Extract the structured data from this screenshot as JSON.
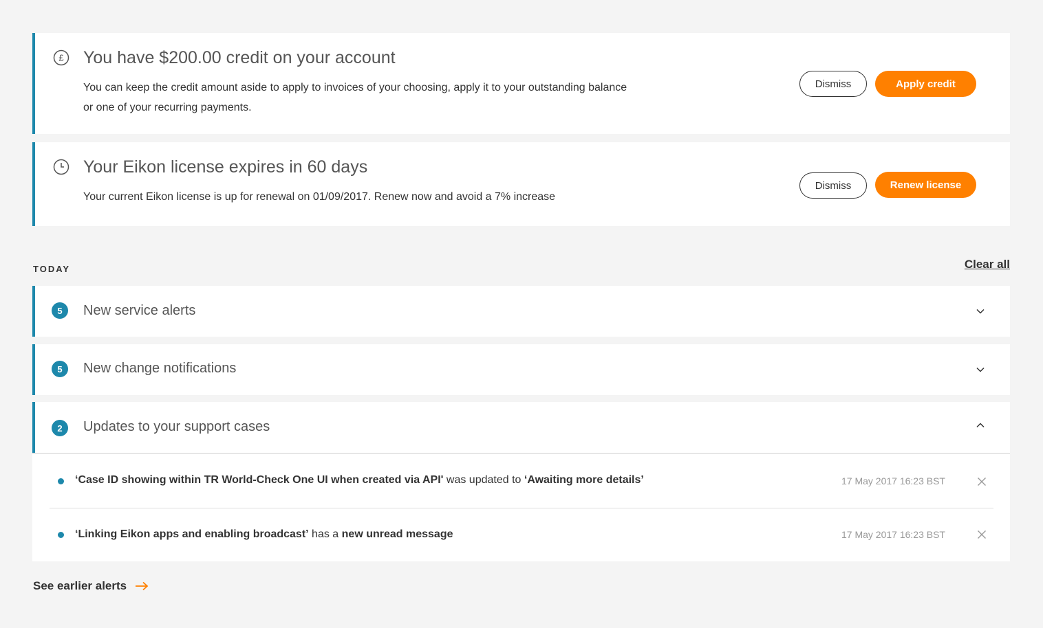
{
  "banners": [
    {
      "title": "You have $200.00 credit on your account",
      "body": "You can keep the credit amount aside to apply to invoices of your choosing, apply it to your outstanding balance or one of your recurring payments.",
      "dismiss_label": "Dismiss",
      "action_label": "Apply credit",
      "icon": "pound-icon"
    },
    {
      "title": "Your Eikon license expires in 60 days",
      "body": "Your current Eikon license is up for renewal on 01/09/2017. Renew now and avoid a 7% increase",
      "dismiss_label": "Dismiss",
      "action_label": "Renew license",
      "icon": "clock-icon"
    }
  ],
  "section": {
    "label": "TODAY",
    "clear_all": "Clear all"
  },
  "groups": [
    {
      "count": "5",
      "title": "New service alerts",
      "expanded": false
    },
    {
      "count": "5",
      "title": "New change notifications",
      "expanded": false
    },
    {
      "count": "2",
      "title": "Updates to your support cases",
      "expanded": true
    }
  ],
  "updates": [
    {
      "case": "‘Case ID showing within TR World-Check One UI when created via API'",
      "middle": " was updated to ",
      "status": "‘Awaiting more details’",
      "time": "17 May 2017 16:23 BST"
    },
    {
      "case": "‘Linking Eikon apps and enabling broadcast’",
      "middle": " has a ",
      "status": "new unread message",
      "time": "17 May 2017 16:23 BST"
    }
  ],
  "footer": {
    "see_earlier": "See earlier alerts"
  },
  "colors": {
    "accent": "#1d88ab",
    "orange": "#ff8000",
    "background": "#f4f4f4"
  }
}
